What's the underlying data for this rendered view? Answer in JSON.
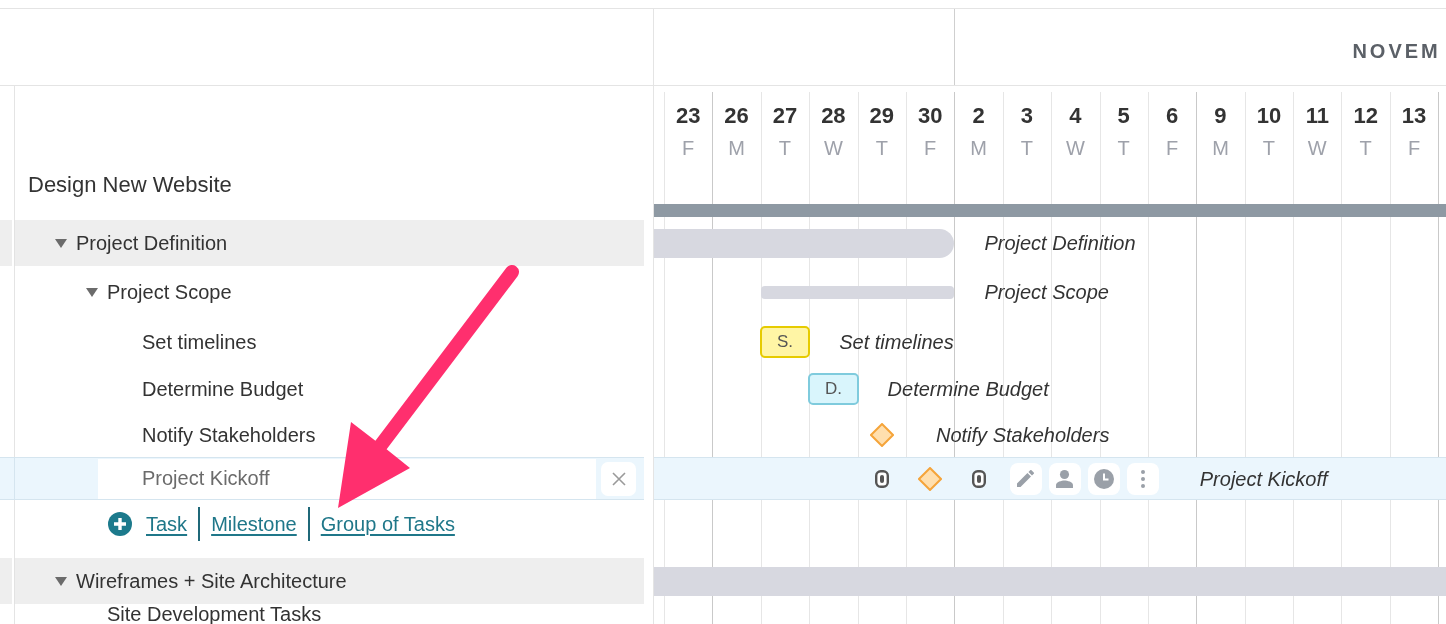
{
  "project": {
    "title": "Design New Website",
    "children": [
      {
        "kind": "group",
        "name": "Project Definition",
        "expanded": true,
        "bar_label": "Project Definition",
        "children": [
          {
            "kind": "group",
            "name": "Project Scope",
            "expanded": true,
            "bar_label": "Project Scope",
            "children": [
              {
                "kind": "task",
                "name": "Set timelines",
                "editing": false,
                "badge": "S.",
                "color": "#fff5a5",
                "bar_label": "Set timelines"
              },
              {
                "kind": "task",
                "name": "Determine Budget",
                "editing": false,
                "badge": "D.",
                "color": "#d9f5fc",
                "bar_label": "Determine Budget"
              },
              {
                "kind": "milestone",
                "name": "Notify Stakeholders",
                "editing": false,
                "bar_label": "Notify Stakeholders"
              },
              {
                "kind": "milestone",
                "name": "Project Kickoff",
                "editing": true,
                "bar_label": "Project Kickoff"
              }
            ],
            "add_options": [
              "Task",
              "Milestone",
              "Group of Tasks"
            ]
          }
        ]
      },
      {
        "kind": "group",
        "name": "Wireframes + Site Architecture",
        "expanded": true,
        "children": [
          {
            "kind": "group",
            "name": "Site Development Tasks"
          }
        ]
      }
    ]
  },
  "timeline": {
    "months": [
      {
        "days": [
          {
            "number": "23",
            "weekday": "F",
            "week_start": false
          },
          {
            "number": "26",
            "weekday": "M",
            "week_start": true
          },
          {
            "number": "27",
            "weekday": "T",
            "week_start": false
          },
          {
            "number": "28",
            "weekday": "W",
            "week_start": false
          },
          {
            "number": "29",
            "weekday": "T",
            "week_start": false
          },
          {
            "number": "30",
            "weekday": "F",
            "week_start": false
          }
        ]
      },
      {
        "label": "NOVEM",
        "days": [
          {
            "number": "2",
            "weekday": "M",
            "week_start": true
          },
          {
            "number": "3",
            "weekday": "T",
            "week_start": false
          },
          {
            "number": "4",
            "weekday": "W",
            "week_start": false
          },
          {
            "number": "5",
            "weekday": "T",
            "week_start": false
          },
          {
            "number": "6",
            "weekday": "F",
            "week_start": false
          },
          {
            "number": "9",
            "weekday": "M",
            "week_start": true
          },
          {
            "number": "10",
            "weekday": "T",
            "week_start": false
          },
          {
            "number": "11",
            "weekday": "W",
            "week_start": false
          },
          {
            "number": "12",
            "weekday": "T",
            "week_start": false
          },
          {
            "number": "13",
            "weekday": "F",
            "week_start": false
          }
        ]
      }
    ]
  }
}
